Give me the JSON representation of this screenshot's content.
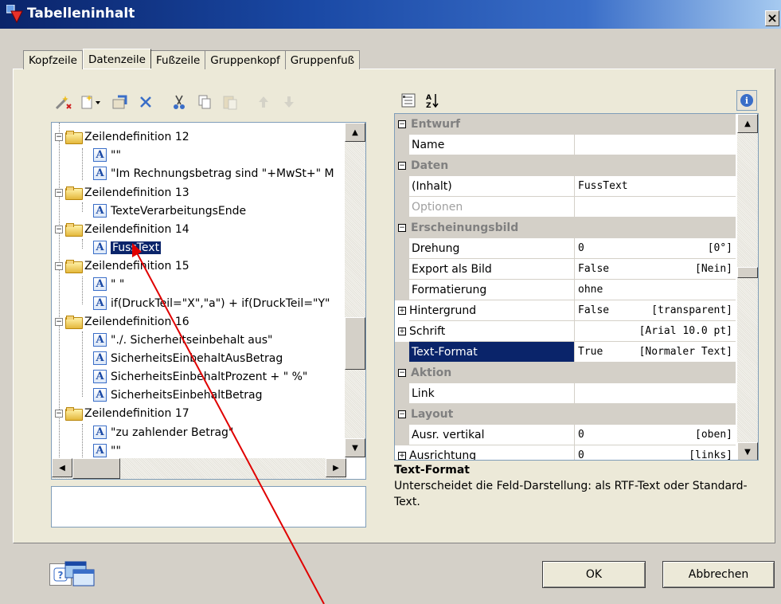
{
  "window": {
    "title": "Tabelleninhalt",
    "close_label": "×"
  },
  "tabs": [
    {
      "label": "Kopfzeile"
    },
    {
      "label": "Datenzeile"
    },
    {
      "label": "Fußzeile"
    },
    {
      "label": "Gruppenkopf"
    },
    {
      "label": "Gruppenfuß"
    }
  ],
  "tree": {
    "items": [
      {
        "type": "folder",
        "label": "Zeilendefinition 12"
      },
      {
        "type": "text",
        "label": "\"\""
      },
      {
        "type": "text",
        "label": "\"Im Rechnungsbetrag sind \"+MwSt+\" M"
      },
      {
        "type": "folder",
        "label": "Zeilendefinition 13"
      },
      {
        "type": "text",
        "label": "TexteVerarbeitungsEnde"
      },
      {
        "type": "folder",
        "label": "Zeilendefinition 14"
      },
      {
        "type": "text",
        "label": "FussText"
      },
      {
        "type": "folder",
        "label": "Zeilendefinition 15"
      },
      {
        "type": "text",
        "label": "\" \""
      },
      {
        "type": "text",
        "label": "if(DruckTeil=\"X\",\"a\") + if(DruckTeil=\"Y\""
      },
      {
        "type": "folder",
        "label": "Zeilendefinition 16"
      },
      {
        "type": "text",
        "label": "\"./. Sicherheitseinbehalt aus\""
      },
      {
        "type": "text",
        "label": "SicherheitsEinbehaltAusBetrag"
      },
      {
        "type": "text",
        "label": "SicherheitsEinbehaltProzent + \" %\""
      },
      {
        "type": "text",
        "label": "SicherheitsEinbehaltBetrag"
      },
      {
        "type": "folder",
        "label": "Zeilendefinition 17"
      },
      {
        "type": "text",
        "label": "\"zu zahlender Betrag\""
      },
      {
        "type": "text",
        "label": "\"\""
      }
    ]
  },
  "properties": {
    "categories": {
      "entwurf": "Entwurf",
      "daten": "Daten",
      "erscheinungsbild": "Erscheinungsbild",
      "aktion": "Aktion",
      "layout": "Layout"
    },
    "rows": {
      "name": {
        "label": "Name",
        "value": "",
        "extra": ""
      },
      "inhalt": {
        "label": "(Inhalt)",
        "value": "FussText",
        "extra": ""
      },
      "optionen": {
        "label": "Optionen",
        "value": "",
        "extra": ""
      },
      "drehung": {
        "label": "Drehung",
        "value": "0",
        "extra": "[0°]"
      },
      "export": {
        "label": "Export als Bild",
        "value": "False",
        "extra": "[Nein]"
      },
      "formatierung": {
        "label": "Formatierung",
        "value": "ohne",
        "extra": ""
      },
      "hintergrund": {
        "label": "Hintergrund",
        "value": "False",
        "extra": "[transparent]"
      },
      "schrift": {
        "label": "Schrift",
        "value": "",
        "extra": "[Arial 10.0 pt]"
      },
      "textformat": {
        "label": "Text-Format",
        "value": "True",
        "extra": "[Normaler Text]"
      },
      "link": {
        "label": "Link",
        "value": "",
        "extra": ""
      },
      "ausr_vertikal": {
        "label": "Ausr. vertikal",
        "value": "0",
        "extra": "[oben]"
      },
      "ausrichtung": {
        "label": "Ausrichtung",
        "value": "0",
        "extra": "[links]"
      }
    },
    "description": {
      "title": "Text-Format",
      "body": "Unterscheidet die Feld-Darstellung: als RTF-Text oder Standard-Text."
    }
  },
  "buttons": {
    "ok": "OK",
    "cancel": "Abbrechen"
  },
  "colors": {
    "selection": "#0a246a",
    "arrow": "#e00000",
    "titlebar": "#0a246a"
  }
}
